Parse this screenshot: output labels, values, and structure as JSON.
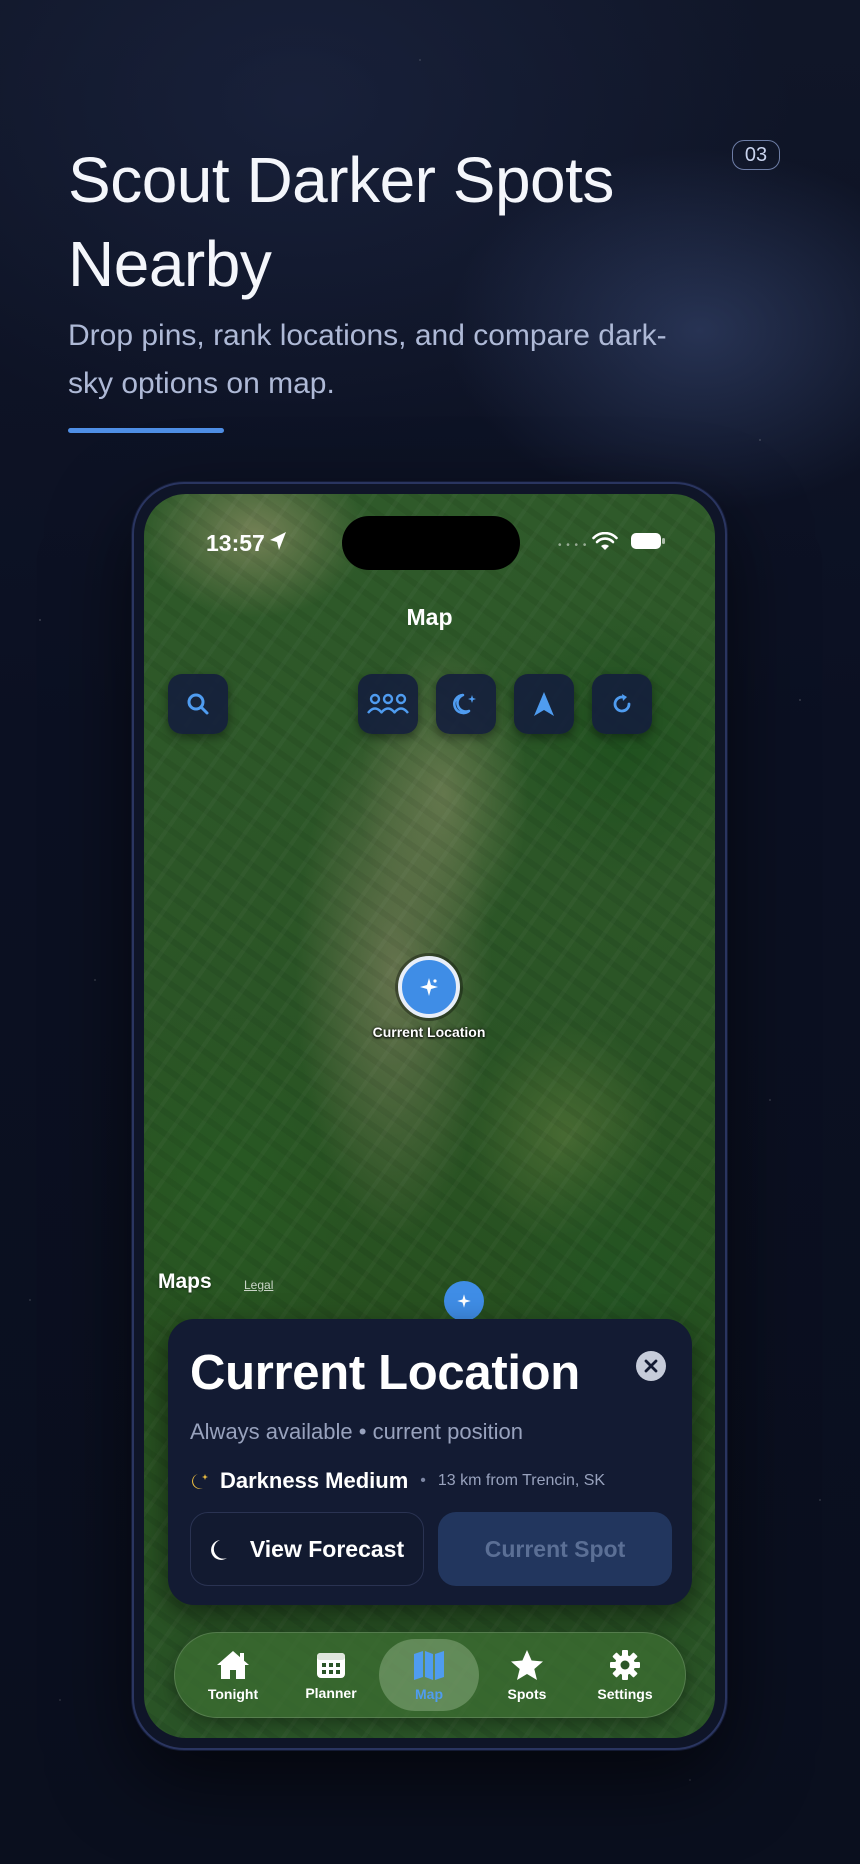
{
  "header": {
    "title": "Scout Darker Spots Nearby",
    "page_number": "03",
    "subtitle": "Drop pins, rank locations, and compare dark-sky options on map.",
    "accent_color": "#4f8fe6"
  },
  "status_bar": {
    "time": "13:57",
    "icons": [
      "location-arrow-icon",
      "wifi-icon",
      "battery-icon"
    ]
  },
  "map": {
    "title": "Map",
    "toolbar": {
      "left": [
        "search-icon"
      ],
      "right": [
        "group-icon",
        "moon-stars-icon",
        "navigation-arrow-icon",
        "refresh-icon"
      ]
    },
    "pin_label": "Current Location",
    "attribution": "Maps",
    "legal": "Legal"
  },
  "card": {
    "title": "Current Location",
    "subtitle": "Always available • current position",
    "darkness": "Darkness Medium",
    "separator": "•",
    "distance": "13 km from Trencin, SK",
    "primary_button": "View Forecast",
    "secondary_button": "Current Spot"
  },
  "tabs": [
    {
      "label": "Tonight",
      "icon": "house-icon",
      "active": false
    },
    {
      "label": "Planner",
      "icon": "calendar-icon",
      "active": false
    },
    {
      "label": "Map",
      "icon": "map-icon",
      "active": true
    },
    {
      "label": "Spots",
      "icon": "star-icon",
      "active": false
    },
    {
      "label": "Settings",
      "icon": "gear-icon",
      "active": false
    }
  ],
  "colors": {
    "background": "#0b1022",
    "button_blue": "#3f8de6",
    "card": "#131b33",
    "active_tab_label": "#4f9cf0"
  }
}
